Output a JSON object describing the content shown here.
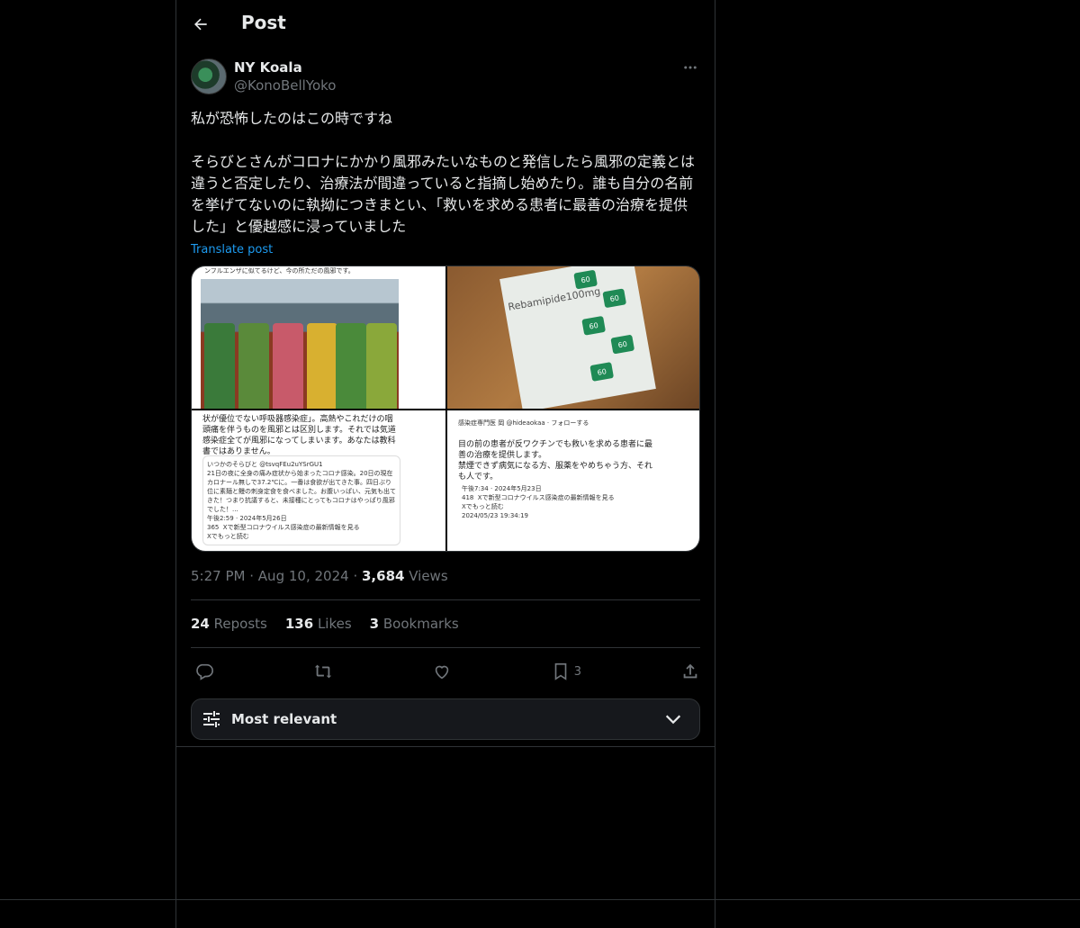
{
  "header": {
    "title": "Post"
  },
  "author": {
    "name": "NY Koala",
    "handle": "@KonoBellYoko"
  },
  "tweet": {
    "text": "私が恐怖したのはこの時ですね\n\nそらびとさんがコロナにかかり風邪みたいなものと発信したら風邪の定義とは違うと否定したり、治療法が間違っていると指摘し始めたり。誰も自分の名前を挙げてないのに執拗につきまとい、「救いを求める患者に最善の治療を提供した」と優越感に浸っていました",
    "translate_label": "Translate post"
  },
  "media": {
    "tile1_caption": "ンフルエンザに似てるけど、今の所ただの風邪です。",
    "tile2_label": "Rebamipide100mg",
    "tile2_pill": "60",
    "tile3_text": "状が優位でない呼吸器感染症」。高熱やこれだけの咽頭痛を伴うものを風邪とは区別します。それでは気道感染症全てが風邪になってしまいます。あなたは教科書ではありません。",
    "tile3_card": "いつかのそらびと @tsvqFEu2uYSrGU1\n21日の夜に全身の痛み症状から始まったコロナ感染。20日の現在カロナール無しで37.2℃に。一番は食欲が出てきた事。四日ぶり位に素麺と鰻の刺身定食を食べました。お腹いっぱい、元気も出てきた！つまり抗議すると、未接種にとってもコロナはやっぱり風邪でした！...\n午後2:59 · 2024年5月26日\n365  Xで新型コロナウイルス感染症の最新情報を見る\nXでもっと読む",
    "tile4_header": "感染症専門医 岡 @hideaokaa · フォローする",
    "tile4_text": "目の前の患者が反ワクチンでも救いを求める患者に最善の治療を提供します。\n禁煙できず病気になる方、服薬をやめちゃう方、それも人です。",
    "tile4_card": "午後7:34 · 2024年5月23日\n418  Xで新型コロナウイルス感染症の最新情報を見る\nXでもっと読む\n2024/05/23 19:34:19"
  },
  "meta": {
    "time": "5:27 PM",
    "dot": "·",
    "date": "Aug 10, 2024",
    "views_count": "3,684",
    "views_label": "Views"
  },
  "stats": {
    "reposts_count": "24",
    "reposts_label": "Reposts",
    "likes_count": "136",
    "likes_label": "Likes",
    "bookmarks_count": "3",
    "bookmarks_label": "Bookmarks"
  },
  "actions": {
    "bookmark_count": "3"
  },
  "sort": {
    "label": "Most relevant"
  },
  "colors": {
    "background": "#000000",
    "text": "#e7e9ea",
    "muted": "#71767b",
    "link": "#1d9bf0",
    "border": "#2f3336"
  },
  "icons": [
    "back-arrow-icon",
    "more-icon",
    "reply-icon",
    "repost-icon",
    "like-icon",
    "bookmark-icon",
    "share-icon",
    "sliders-icon",
    "chevron-down-icon"
  ]
}
